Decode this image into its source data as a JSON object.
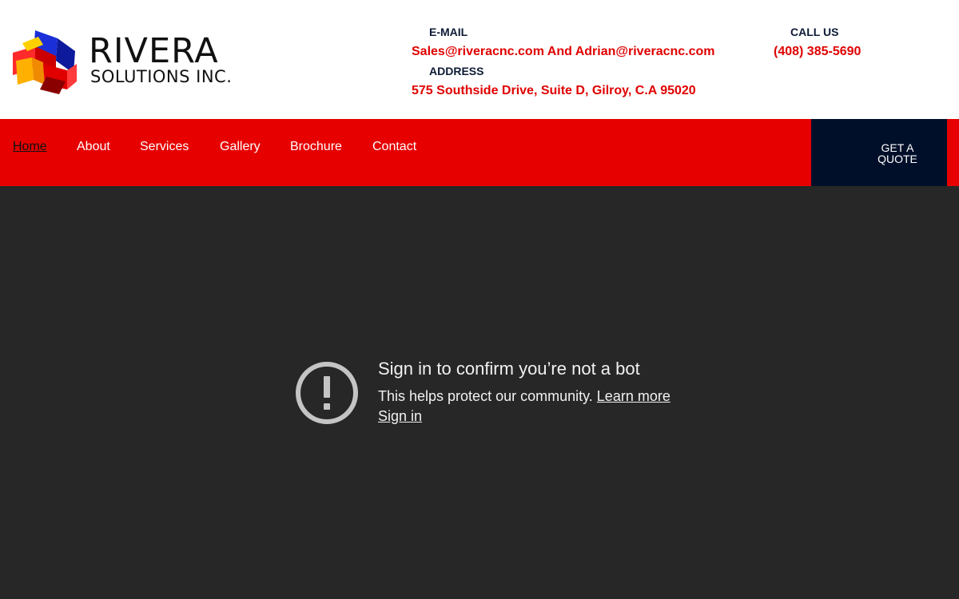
{
  "brand": {
    "name": "RIVERA",
    "tagline": "SOLUTIONS INC."
  },
  "contact": {
    "email_label": "E-MAIL",
    "email_value": "Sales@riveracnc.com And Adrian@riveracnc.com",
    "address_label": "ADDRESS",
    "address_value": "575 Southside Drive, Suite D, Gilroy, C.A 95020",
    "phone_label": "CALL US",
    "phone_value": "(408) 385-5690"
  },
  "nav": {
    "items": [
      {
        "label": "Home",
        "active": true
      },
      {
        "label": "About"
      },
      {
        "label": "Services"
      },
      {
        "label": "Gallery"
      },
      {
        "label": "Brochure"
      },
      {
        "label": "Contact"
      }
    ],
    "quote_button": "GET A QUOTE"
  },
  "bot_check": {
    "title": "Sign in to confirm you’re not a bot",
    "body": "This helps protect our community.",
    "learn_more": "Learn more",
    "sign_in": "Sign in",
    "icon": "alert-circle-icon"
  },
  "colors": {
    "accent_red": "#e60000",
    "text_red": "#e00000",
    "navy": "#000f29",
    "dark_bg": "#272727"
  }
}
